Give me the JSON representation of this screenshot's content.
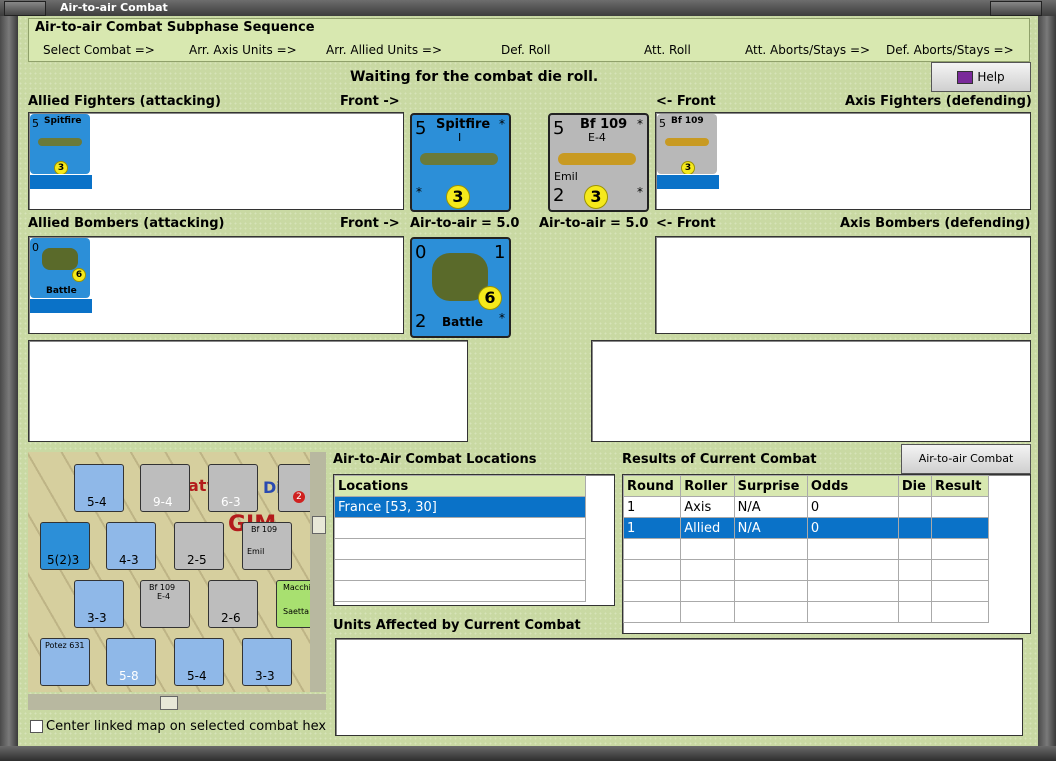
{
  "window": {
    "title": "Air-to-air Combat"
  },
  "sequence": {
    "title": "Air-to-air Combat Subphase Sequence",
    "steps": [
      "Select Combat =>",
      "Arr. Axis Units =>",
      "Arr. Allied Units =>",
      "Def. Roll",
      "Att. Roll",
      "Att. Aborts/Stays =>",
      "Def. Aborts/Stays =>"
    ]
  },
  "status": "Waiting for the combat die roll.",
  "help_label": "Help",
  "allied_fighters": {
    "label": "Allied Fighters (attacking)",
    "front": "Front ->"
  },
  "axis_fighters": {
    "label": "Axis Fighters (defending)",
    "front": "<- Front"
  },
  "allied_bombers": {
    "label": "Allied Bombers (attacking)",
    "front": "Front ->"
  },
  "axis_bombers": {
    "label": "Axis Bombers (defending)",
    "front": "<- Front"
  },
  "air_to_air_allied": "Air-to-air = 5.0",
  "air_to_air_axis": "Air-to-air = 5.0",
  "units": {
    "spitfire": {
      "name": "Spitfire",
      "sub": "I",
      "attack": "5",
      "defense": "3",
      "star": "*"
    },
    "bf109": {
      "name": "Bf 109",
      "sub": "E-4",
      "pilot": "Emil",
      "attack": "5",
      "bottom": "2",
      "defense": "3",
      "star": "*"
    },
    "battle": {
      "name": "Battle",
      "top_left": "0",
      "top_right": "1",
      "bottom": "2",
      "defense": "6",
      "star": "*"
    }
  },
  "locations": {
    "title": "Air-to-Air Combat Locations",
    "header": "Locations",
    "items": [
      "France [53, 30]"
    ]
  },
  "results": {
    "title": "Results of Current Combat",
    "chart_button": "Air-to-air Combat Chart",
    "headers": [
      "Round",
      "Roller",
      "Surprise",
      "Odds",
      "Die",
      "Result"
    ],
    "rows": [
      [
        "1",
        "Axis",
        "N/A",
        "0",
        "",
        ""
      ],
      [
        "1",
        "Allied",
        "N/A",
        "0",
        "",
        ""
      ]
    ]
  },
  "affected": {
    "title": "Units Affected by Current Combat"
  },
  "map_option": "Center linked map on selected combat hex",
  "map_labels": {
    "c1": "5-4",
    "c2": "9-4",
    "c3": "6-3",
    "c4": "5(2)3",
    "c5": "4-3",
    "c6": "2-5",
    "c7": "3-3",
    "c8": "2-6",
    "c9": "5-8",
    "c10": "5-4",
    "c11": "3-3",
    "bf_name": "Bf 109",
    "bf_sub": "E-4",
    "potez": "Potez 631",
    "macchi": "Macchi",
    "saetta": "Saetta",
    "stack": "2",
    "stack3": "3",
    "xxx": "xxx",
    "xx": "XX",
    "r": "R",
    "emil": "Emil",
    "map_text1": "atw",
    "map_text2": "Di",
    "map_text3": "GIM"
  }
}
